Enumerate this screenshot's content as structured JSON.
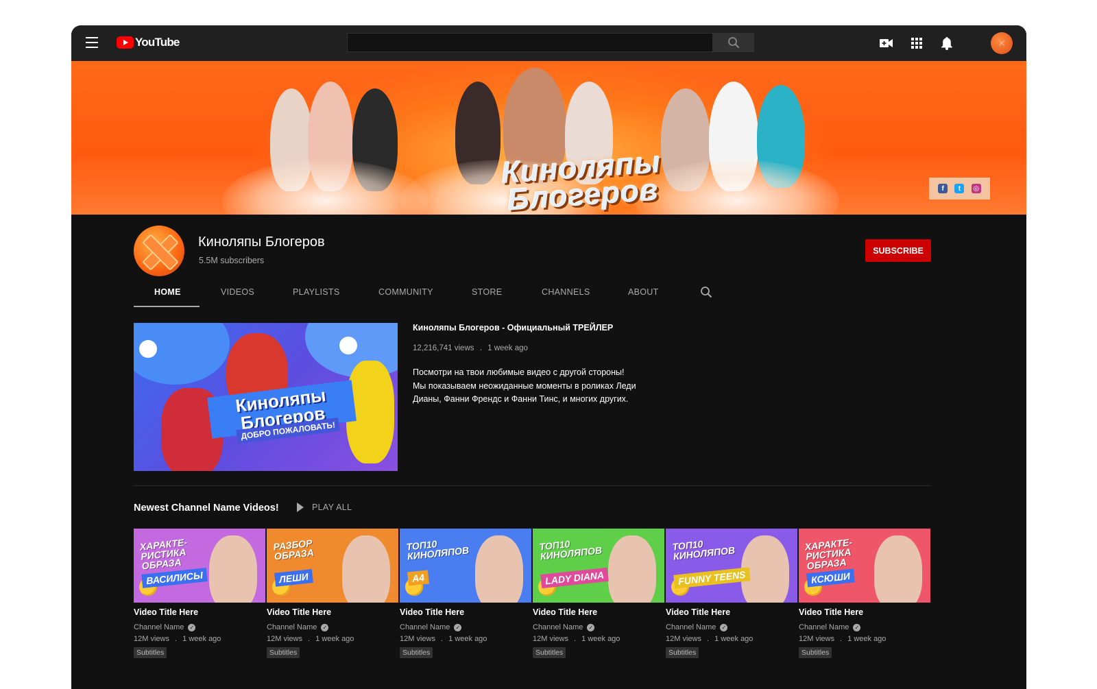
{
  "app": {
    "logo_text": "YouTube"
  },
  "topbar": {
    "search_value": "",
    "icons": [
      "menu-icon",
      "search-icon",
      "create-video-icon",
      "apps-grid-icon",
      "bell-icon",
      "account-avatar"
    ]
  },
  "banner": {
    "title_line1": "Киноляпы",
    "title_line2": "Блогеров",
    "social": {
      "facebook": "f",
      "twitter": "t",
      "instagram": "◎"
    }
  },
  "channel": {
    "name": "Киноляпы Блогеров",
    "subscribers": "5.5M subscribers",
    "subscribe_label": "SUBSCRIBE"
  },
  "tabs": {
    "home": "HOME",
    "videos": "VIDEOS",
    "playlists": "PLAYLISTS",
    "community": "COMMUNITY",
    "store": "STORE",
    "channels": "CHANNELS",
    "about": "ABOUT",
    "active": "HOME"
  },
  "featured": {
    "title": "Киноляпы Блогеров - Официальный ТРЕЙЛЕР",
    "views": "12,216,741 views",
    "sep": ".",
    "age": "1 week ago",
    "desc_line1": "Посмотри на твои любимые видео с другой стороны!",
    "desc_line2": "Мы показываем неожиданные моменты в роликах Леди",
    "desc_line3": "Дианы, Фанни Френдс и  Фанни Тинс, и многих других.",
    "thumb_title_1": "Киноляпы",
    "thumb_title_2": "Блогеров",
    "thumb_sub": "ДОБРО ПОЖАЛОВАТЬ!"
  },
  "shelf": {
    "title": "Newest Channel Name Videos!",
    "play_all": "PLAY ALL",
    "videos": [
      {
        "title": "Video Title Here",
        "channel": "Channel Name",
        "views": "12M views",
        "age": "1 week ago",
        "badge": "Subtitles",
        "thumb_top": "ХАРАКТЕ-РИСТИКА ОБРАЗА",
        "thumb_hl": "ВАСИЛИСЫ",
        "bg": "#c36ae0",
        "hlbg": "#3a6ff0"
      },
      {
        "title": "Video Title Here",
        "channel": "Channel Name",
        "views": "12M views",
        "age": "1 week ago",
        "badge": "Subtitles",
        "thumb_top": "РАЗБОР ОБРАЗА",
        "thumb_hl": "ЛЕШИ",
        "bg": "#f08a2e",
        "hlbg": "#3a6ff0"
      },
      {
        "title": "Video Title Here",
        "channel": "Channel Name",
        "views": "12M views",
        "age": "1 week ago",
        "badge": "Subtitles",
        "thumb_top": "ТОП10 КИНОЛЯПОВ",
        "thumb_hl": "А4",
        "bg": "#4a7ef0",
        "hlbg": "#f0a020"
      },
      {
        "title": "Video Title Here",
        "channel": "Channel Name",
        "views": "12M views",
        "age": "1 week ago",
        "badge": "Subtitles",
        "thumb_top": "ТОП10 КИНОЛЯПОВ",
        "thumb_hl": "LADY DIANA",
        "bg": "#5fcf4a",
        "hlbg": "#e04a9a"
      },
      {
        "title": "Video Title Here",
        "channel": "Channel Name",
        "views": "12M views",
        "age": "1 week ago",
        "badge": "Subtitles",
        "thumb_top": "ТОП10 КИНОЛЯПОВ",
        "thumb_hl": "FUNNY TEENS",
        "bg": "#8a5ae8",
        "hlbg": "#e8c020"
      },
      {
        "title": "Video Title Here",
        "channel": "Channel Name",
        "views": "12M views",
        "age": "1 week ago",
        "badge": "Subtitles",
        "thumb_top": "ХАРАКТЕ-РИСТИКА ОБРАЗА",
        "thumb_hl": "КСЮШИ",
        "bg": "#f0566a",
        "hlbg": "#3a6ff0"
      }
    ]
  },
  "colors": {
    "accent": "#cc0000",
    "bg": "#111111",
    "topbar": "#202020",
    "banner": "#ff5a10"
  }
}
